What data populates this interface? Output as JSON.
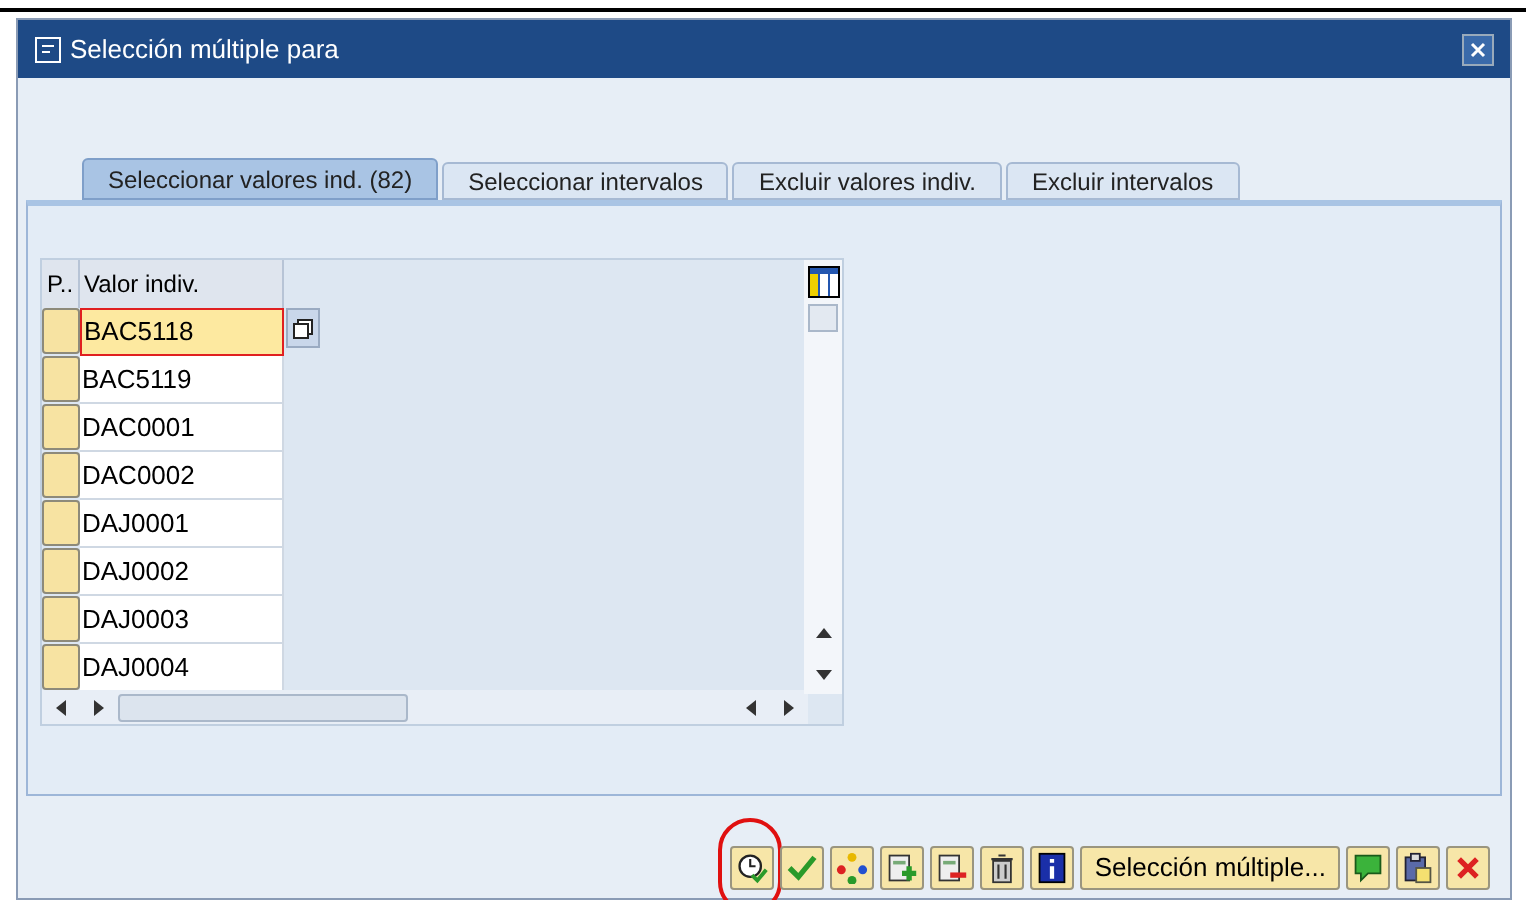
{
  "window": {
    "title": "Selección múltiple para"
  },
  "tabs": [
    {
      "label": "Seleccionar valores ind. (82)",
      "selected": true
    },
    {
      "label": "Seleccionar intervalos",
      "selected": false
    },
    {
      "label": "Excluir valores indiv.",
      "selected": false
    },
    {
      "label": "Excluir intervalos",
      "selected": false
    }
  ],
  "table": {
    "columns": [
      "P..",
      "Valor indiv."
    ],
    "rows": [
      {
        "value": "BAC5118",
        "focused": true
      },
      {
        "value": "BAC5119",
        "focused": false
      },
      {
        "value": "DAC0001",
        "focused": false
      },
      {
        "value": "DAC0002",
        "focused": false
      },
      {
        "value": "DAJ0001",
        "focused": false
      },
      {
        "value": "DAJ0002",
        "focused": false
      },
      {
        "value": "DAJ0003",
        "focused": false
      },
      {
        "value": "DAJ0004",
        "focused": false
      }
    ]
  },
  "toolbar": [
    {
      "kind": "icon",
      "highlighted": true
    },
    {
      "kind": "icon",
      "highlighted": false
    },
    {
      "kind": "icon",
      "highlighted": false
    },
    {
      "kind": "icon",
      "highlighted": false
    },
    {
      "kind": "icon",
      "highlighted": false
    },
    {
      "kind": "icon",
      "highlighted": false
    },
    {
      "kind": "icon",
      "highlighted": false
    },
    {
      "kind": "text",
      "label": "Selección múltiple...",
      "highlighted": false
    },
    {
      "kind": "icon",
      "highlighted": false
    },
    {
      "kind": "icon",
      "highlighted": false
    },
    {
      "kind": "icon",
      "highlighted": false
    }
  ]
}
